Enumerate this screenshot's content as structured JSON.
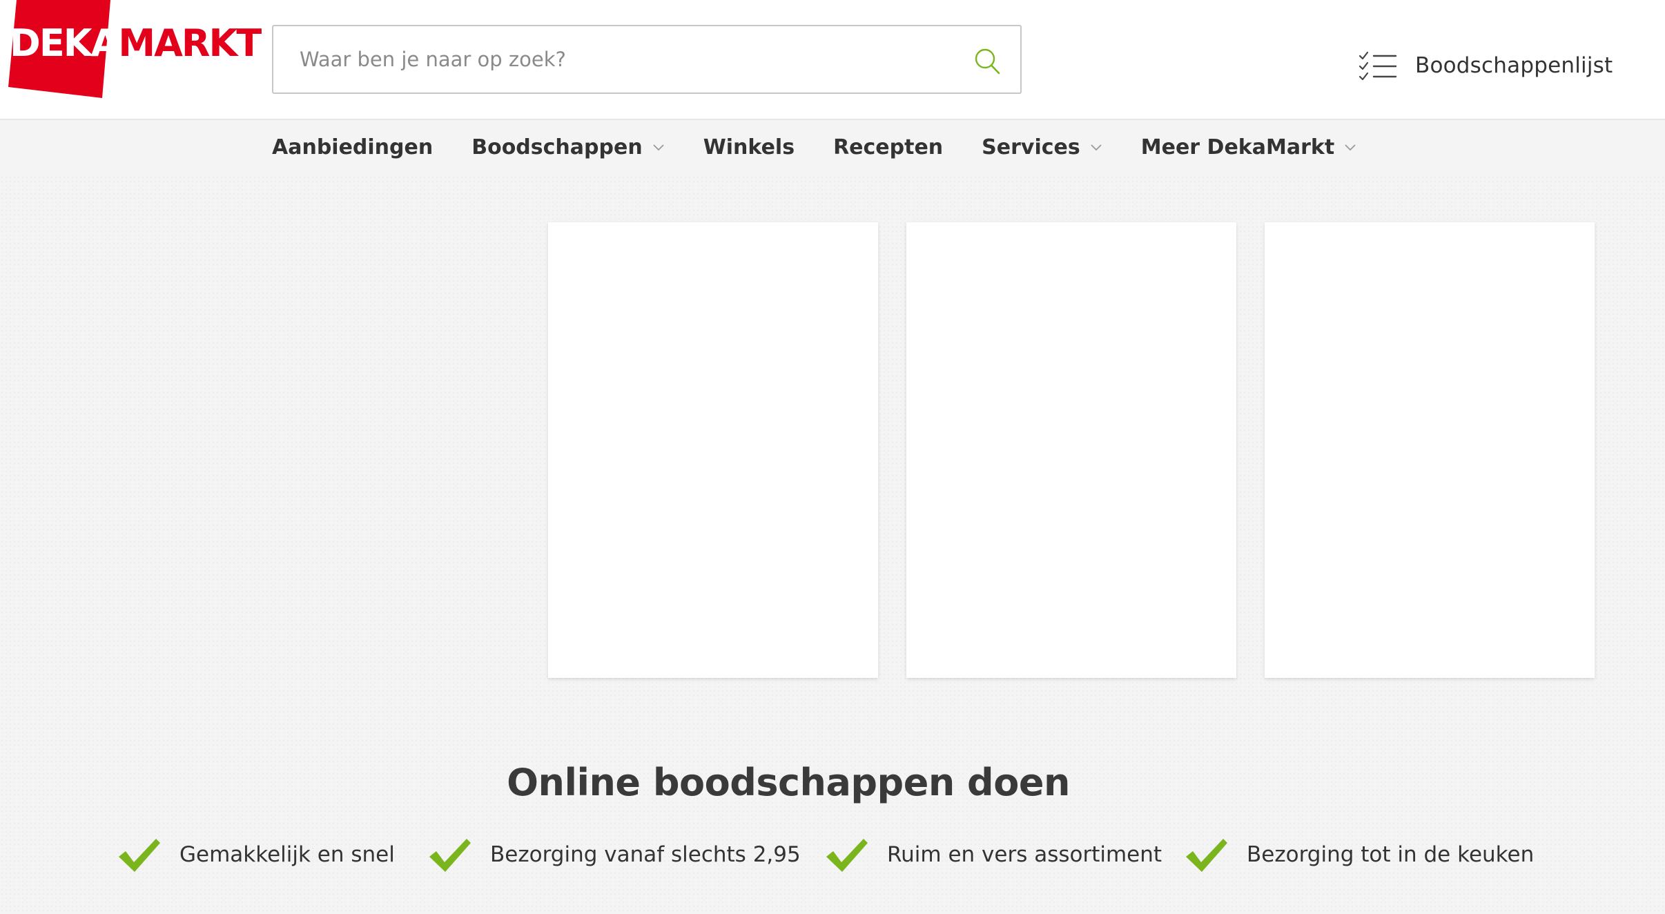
{
  "brand": {
    "logo_part1": "DEKA",
    "logo_part2": "MARKT",
    "red": "#e2001a",
    "accent_green": "#7ab51d"
  },
  "search": {
    "placeholder": "Waar ben je naar op zoek?",
    "icon": "search-icon"
  },
  "shopping_list": {
    "label": "Boodschappenlijst",
    "icon": "checklist-icon"
  },
  "nav": {
    "items": [
      {
        "label": "Aanbiedingen",
        "has_dropdown": false
      },
      {
        "label": "Boodschappen",
        "has_dropdown": true
      },
      {
        "label": "Winkels",
        "has_dropdown": false
      },
      {
        "label": "Recepten",
        "has_dropdown": false
      },
      {
        "label": "Services",
        "has_dropdown": true
      },
      {
        "label": "Meer DekaMarkt",
        "has_dropdown": true
      }
    ]
  },
  "main": {
    "section_title": "Online boodschappen doen",
    "usps": [
      {
        "label": "Gemakkelijk en snel",
        "icon": "checkmark-icon"
      },
      {
        "label": "Bezorging vanaf slechts 2,95",
        "icon": "checkmark-icon"
      },
      {
        "label": "Ruim en vers assortiment",
        "icon": "checkmark-icon"
      },
      {
        "label": "Bezorging tot in de keuken",
        "icon": "checkmark-icon"
      }
    ]
  }
}
